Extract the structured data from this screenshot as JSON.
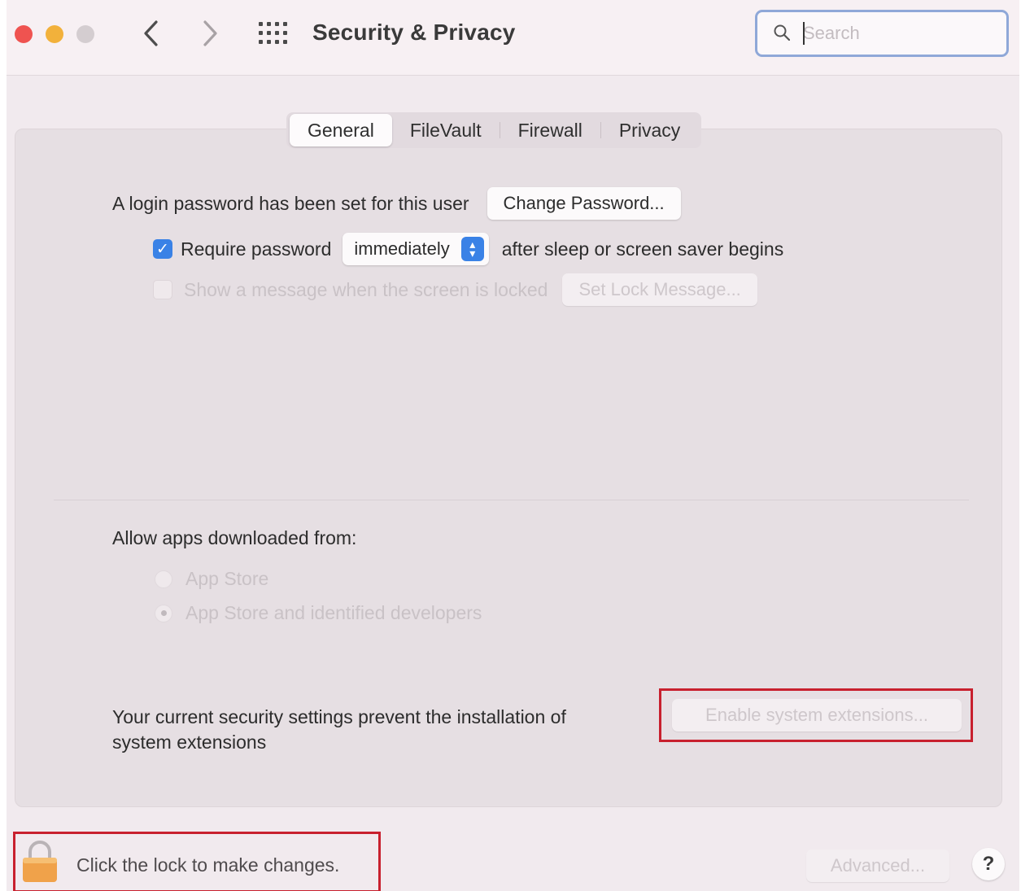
{
  "window": {
    "title": "Security & Privacy",
    "search_placeholder": "Search"
  },
  "tabs": [
    {
      "label": "General",
      "active": true
    },
    {
      "label": "FileVault",
      "active": false
    },
    {
      "label": "Firewall",
      "active": false
    },
    {
      "label": "Privacy",
      "active": false
    }
  ],
  "general": {
    "login_password_text": "A login password has been set for this user",
    "change_password_button": "Change Password...",
    "require_password_label": "Require password",
    "require_password_checked": true,
    "require_password_select_value": "immediately",
    "after_sleep_text": "after sleep or screen saver begins",
    "show_message_label": "Show a message when the screen is locked",
    "show_message_checked": false,
    "set_lock_message_button": "Set Lock Message...",
    "allow_apps_label": "Allow apps downloaded from:",
    "allow_apps_options": [
      {
        "label": "App Store",
        "selected": false
      },
      {
        "label": "App Store and identified developers",
        "selected": true
      }
    ],
    "security_notice_line1": "Your current security settings prevent the installation of",
    "security_notice_line2": "system extensions",
    "enable_extensions_button": "Enable system extensions..."
  },
  "footer": {
    "lock_text": "Click the lock to make changes.",
    "advanced_button": "Advanced...",
    "help_button": "?"
  },
  "colors": {
    "accent": "#3a82e6",
    "highlight_box": "#c8202e",
    "close": "#ef5350",
    "minimize": "#f2b13b",
    "lock": "#f0a24a"
  }
}
